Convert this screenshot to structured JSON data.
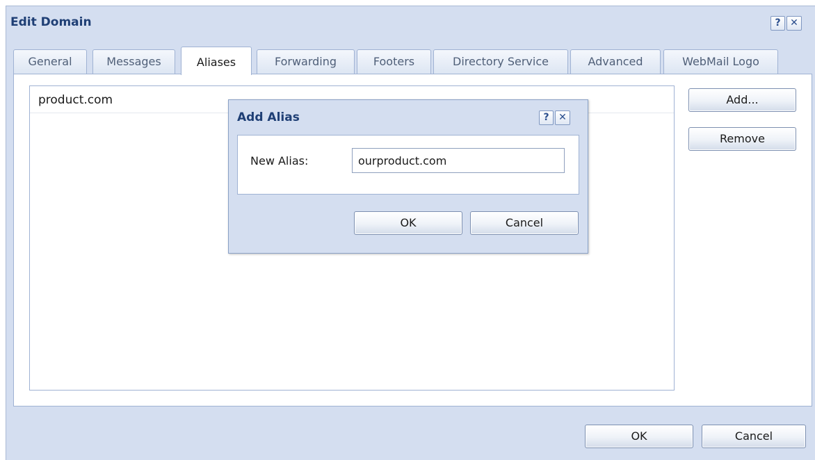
{
  "main_dialog": {
    "title": "Edit Domain",
    "help_glyph": "?",
    "close_glyph": "✕",
    "tabs": [
      {
        "label": "General",
        "active": false
      },
      {
        "label": "Messages",
        "active": false
      },
      {
        "label": "Aliases",
        "active": true
      },
      {
        "label": "Forwarding",
        "active": false
      },
      {
        "label": "Footers",
        "active": false
      },
      {
        "label": "Directory Service",
        "active": false
      },
      {
        "label": "Advanced",
        "active": false
      },
      {
        "label": "WebMail Logo",
        "active": false
      }
    ],
    "aliases": [
      "product.com"
    ],
    "add_label": "Add...",
    "remove_label": "Remove",
    "ok_label": "OK",
    "cancel_label": "Cancel"
  },
  "add_alias_dialog": {
    "title": "Add Alias",
    "help_glyph": "?",
    "close_glyph": "✕",
    "field_label": "New Alias:",
    "field_value": "ourproduct.com",
    "ok_label": "OK",
    "cancel_label": "Cancel"
  },
  "colors": {
    "title_text": "#1f3f75",
    "dialog_bg": "#d4def0",
    "border": "#9fb2d3"
  },
  "icons": {
    "help": "help-icon",
    "close": "close-icon"
  }
}
